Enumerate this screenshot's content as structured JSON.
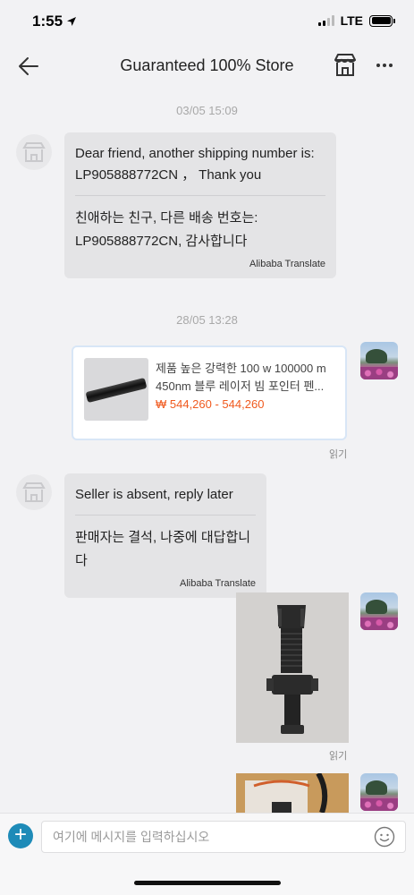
{
  "status": {
    "time": "1:55",
    "network": "LTE"
  },
  "header": {
    "title": "Guaranteed 100% Store"
  },
  "messages": {
    "ts1": "03/05 15:09",
    "msg1": {
      "original": "Dear friend, another shipping number is: LP905888772CN ， Thank you",
      "translated": "친애하는 친구, 다른 배송 번호는: LP905888772CN, 감사합니다",
      "tag": "Alibaba Translate"
    },
    "ts2": "28/05 13:28",
    "product": {
      "title": "제품 높은 강력한 100 w 100000 m 450nm 블루 레이저 빔 포인터 펜...",
      "price": "₩ 544,260 - 544,260",
      "read": "읽기"
    },
    "msg2": {
      "original": "Seller is absent, reply later",
      "translated": "판매자는 결석, 나중에 대답합니다",
      "tag": "Alibaba Translate"
    },
    "photo_read": "읽기"
  },
  "composer": {
    "placeholder": "여기에 메시지를 입력하십시오"
  },
  "colors": {
    "accent": "#1e8bb8",
    "price": "#f05a1f",
    "bubble": "#e4e4e6"
  }
}
